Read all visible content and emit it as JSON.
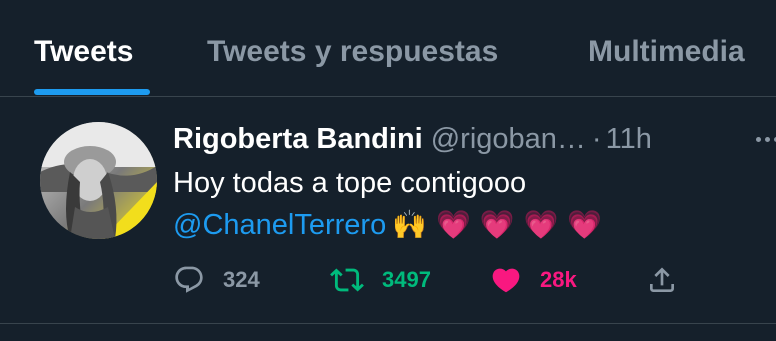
{
  "tabs": [
    {
      "label": "Tweets",
      "active": true
    },
    {
      "label": "Tweets y respuestas",
      "active": false
    },
    {
      "label": "Multimedia",
      "active": false
    }
  ],
  "tweet": {
    "author_name": "Rigoberta Bandini",
    "handle": "@rigoban…",
    "separator": "·",
    "time": "11h",
    "text_line1": "Hoy todas a tope contigooo",
    "mention": "@ChanelTerrero",
    "emojis": "🙌 💗 💗 💗 💗",
    "actions": {
      "replies": "324",
      "retweets": "3497",
      "likes": "28k",
      "liked": true,
      "retweeted": true
    }
  },
  "colors": {
    "background": "#15202b",
    "accent": "#1d9bf0",
    "retweet": "#00ba7c",
    "like": "#f91880",
    "muted": "#8b98a5"
  },
  "icons": [
    "reply-icon",
    "retweet-icon",
    "heart-icon",
    "share-icon",
    "more-options-icon"
  ]
}
